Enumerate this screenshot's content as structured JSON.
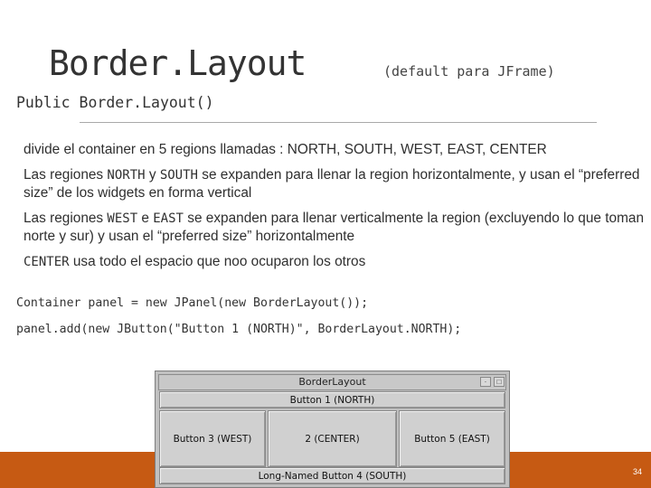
{
  "slide": {
    "title": "Border.Layout",
    "subtitle": "(default para JFrame)",
    "constructor": "Public Border.Layout()",
    "page_number": "34"
  },
  "bullets": [
    {
      "text": "divide el container en 5 regions llamadas : NORTH, SOUTH, WEST, EAST, CENTER"
    },
    {
      "pre": "Las regiones ",
      "kw1": "NORTH",
      "mid": " y ",
      "kw2": "SOUTH",
      "post": " se expanden para llenar la region horizontalmente, y usan el “preferred size” de los widgets en forma vertical"
    },
    {
      "pre": "Las regiones ",
      "kw1": "WEST",
      "mid": " e ",
      "kw2": "EAST",
      "post": " se expanden para llenar verticalmente la region (excluyendo lo que toman norte y sur)  y usan el “preferred size” horizontalmente"
    },
    {
      "kw1": "CENTER",
      "post": " usa todo el espacio que noo ocuparon los otros"
    }
  ],
  "code": {
    "line1": "Container panel = new JPanel(new BorderLayout());",
    "line2": "panel.add(new JButton(\"Button 1 (NORTH)\", BorderLayout.NORTH);"
  },
  "window": {
    "title": "BorderLayout",
    "north": "Button 1 (NORTH)",
    "west": "Button 3 (WEST)",
    "center": "2 (CENTER)",
    "east": "Button 5 (EAST)",
    "south": "Long-Named Button 4 (SOUTH)"
  },
  "colors": {
    "footer": "#c65a13",
    "rule": "#a9a9a9"
  }
}
